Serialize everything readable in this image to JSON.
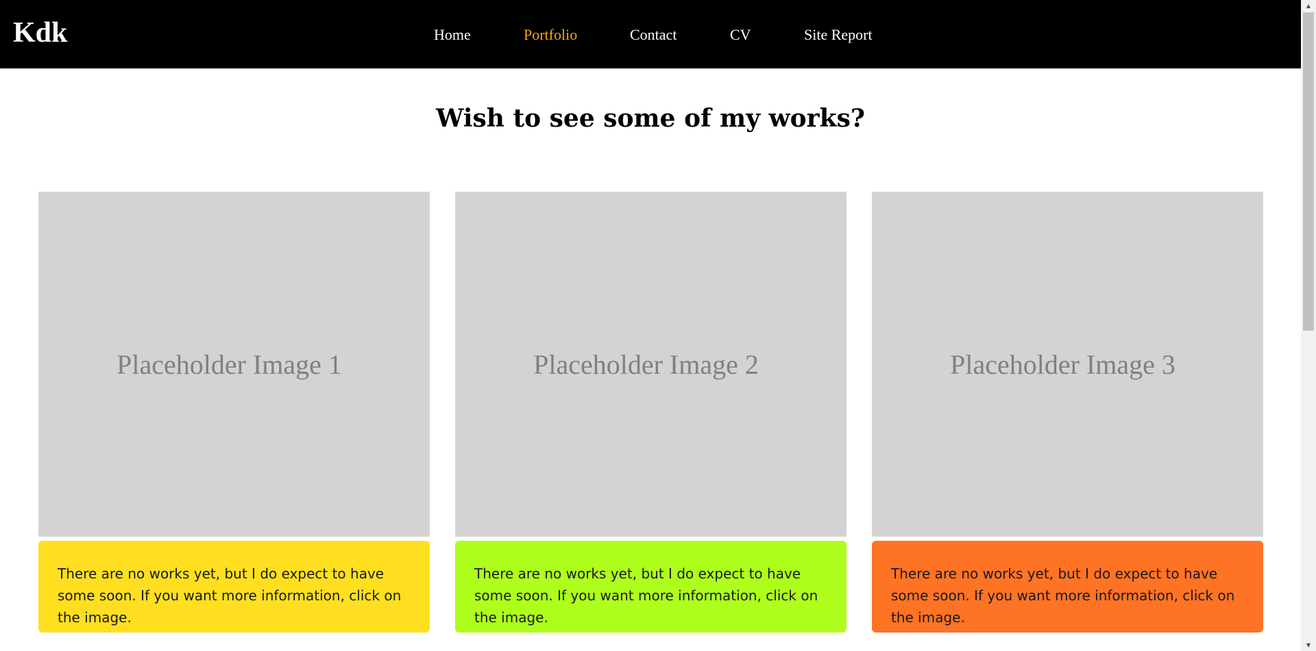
{
  "nav": {
    "logo": "Kdk",
    "items": [
      {
        "label": "Home"
      },
      {
        "label": "Portfolio",
        "active": true
      },
      {
        "label": "Contact"
      },
      {
        "label": "CV"
      },
      {
        "label": "Site Report"
      }
    ],
    "active_color": "#ffa31a"
  },
  "heading": "Wish to see some of my works?",
  "cards": [
    {
      "image_label": "Placeholder Image 1",
      "caption": "There are no works yet, but I do expect to have some soon. If you want more information, click on the image.",
      "color": "#ffdf20"
    },
    {
      "image_label": "Placeholder Image 2",
      "caption": "There are no works yet, but I do expect to have some soon. If you want more information, click on the image.",
      "color": "#aeff1c"
    },
    {
      "image_label": "Placeholder Image 3",
      "caption": "There are no works yet, but I do expect to have some soon. If you want more information, click on the image.",
      "color": "#ff7325"
    }
  ],
  "scrollbar": {
    "up_icon": "triangle-up-icon",
    "down_icon": "triangle-down-icon"
  }
}
